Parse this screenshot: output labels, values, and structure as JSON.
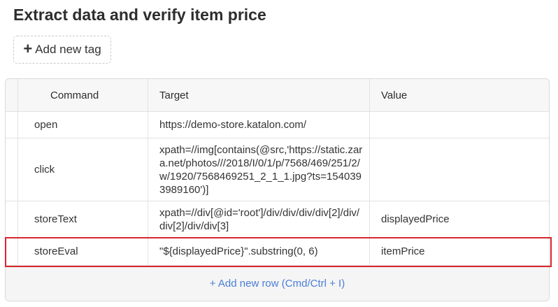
{
  "page": {
    "title": "Extract data and verify item price"
  },
  "tags": {
    "add_tag_label": "Add new tag",
    "plus_glyph": "+"
  },
  "table": {
    "headers": {
      "command": "Command",
      "target": "Target",
      "value": "Value"
    },
    "rows": [
      {
        "command": "open",
        "target": "https://demo-store.katalon.com/",
        "value": ""
      },
      {
        "command": "click",
        "target": "xpath=//img[contains(@src,'https://static.zara.net/photos///2018/I/0/1/p/7568/469/251/2/w/1920/7568469251_2_1_1.jpg?ts=1540393989160')]",
        "value": ""
      },
      {
        "command": "storeText",
        "target": "xpath=//div[@id='root']/div/div/div/div[2]/div/div[2]/div/div[3]",
        "value": "displayedPrice"
      },
      {
        "command": "storeEval",
        "target": "\"${displayedPrice}\".substring(0, 6)",
        "value": "itemPrice"
      }
    ],
    "add_row_label": "+ Add new row (Cmd/Ctrl + I)"
  },
  "colors": {
    "highlight": "#d9262e",
    "link": "#4a7ed8"
  }
}
